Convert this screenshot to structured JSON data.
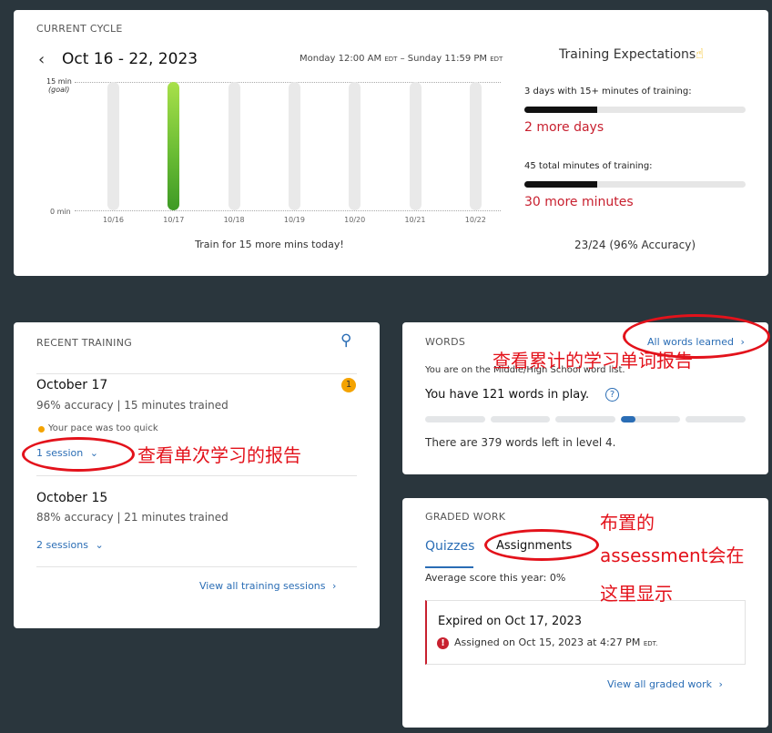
{
  "cycle": {
    "caption": "CURRENT CYCLE",
    "range": "Oct 16 - 22, 2023",
    "window": {
      "start": "Monday 12:00 AM",
      "start_tz": "EDT",
      "sep": "–",
      "end": "Sunday 11:59 PM",
      "end_tz": "EDT"
    },
    "y_top": "15 min",
    "y_goal": "(goal)",
    "y_bottom": "0 min",
    "days": [
      "10/16",
      "10/17",
      "10/18",
      "10/19",
      "10/20",
      "10/21",
      "10/22"
    ],
    "footer": "Train for 15 more mins today!",
    "expectations_title": "Training Expectations",
    "expectations_icon": "pointing-hand-icon",
    "exp1_label": "3 days with 15+ minutes of training:",
    "exp1_progress": 0.33,
    "exp1_remaining": "2 more days",
    "exp2_label": "45 total minutes of training:",
    "exp2_progress": 0.33,
    "exp2_remaining": "30 more minutes",
    "accuracy": "23/24 (96% Accuracy)"
  },
  "chart_data": {
    "type": "bar",
    "categories": [
      "10/16",
      "10/17",
      "10/18",
      "10/19",
      "10/20",
      "10/21",
      "10/22"
    ],
    "values": [
      0,
      15,
      0,
      0,
      0,
      0,
      0
    ],
    "ylim": [
      0,
      15
    ],
    "ylabel": "",
    "xlabel": "",
    "title": ""
  },
  "recent": {
    "caption": "RECENT TRAINING",
    "search_icon": "search-icon",
    "entries": [
      {
        "date": "October 17",
        "badge": "1",
        "stats": "96% accuracy | 15 minutes trained",
        "note": "Your pace was too quick",
        "sessions": "1 session"
      },
      {
        "date": "October 15",
        "stats": "88% accuracy | 21 minutes trained",
        "sessions": "2 sessions"
      }
    ],
    "view_all": "View all training sessions"
  },
  "words": {
    "caption": "WORDS",
    "all_link": "All words learned",
    "list_note": "You are on the Middle/High School word list.",
    "in_play": "You have 121 words in play.",
    "help": "?",
    "level_progress": 0.25,
    "left": "There are 379 words left in level 4."
  },
  "graded": {
    "caption": "GRADED WORK",
    "tabs": [
      "Quizzes",
      "Assignments"
    ],
    "avg": "Average score this year: 0%",
    "expired": "Expired on Oct 17, 2023",
    "assigned": "Assigned on Oct 15, 2023 at 4:27 PM",
    "assigned_tz": "EDT.",
    "view_all": "View all graded work"
  },
  "annotations": {
    "words": "查看累计的学习单词报告",
    "session": "查看单次学习的报告",
    "assign_lines": [
      "布置的",
      "assessment会在",
      "这里显示"
    ]
  },
  "colors": {
    "background": "#2a363d",
    "link": "#2a6db5",
    "alert": "#c8202f",
    "bar": "#6bbd35",
    "annotation": "#e3121b"
  }
}
